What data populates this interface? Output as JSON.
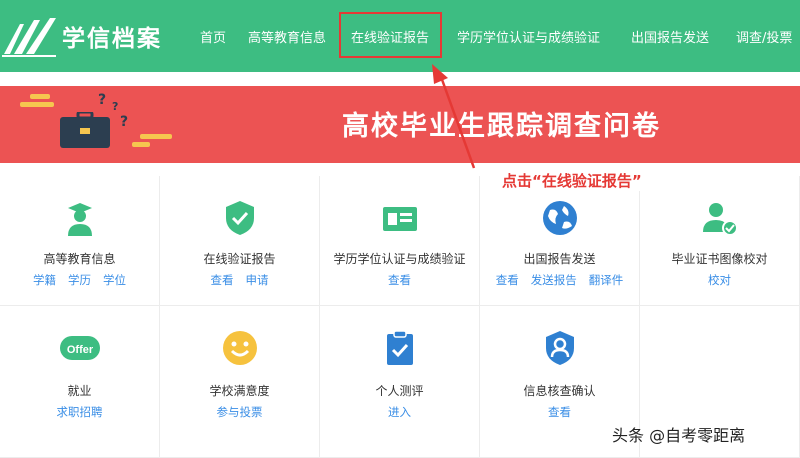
{
  "header": {
    "logo_text": "学信档案",
    "nav": [
      "首页",
      "高等教育信息",
      "在线验证报告",
      "学历学位认证与成绩验证",
      "出国报告发送",
      "调查/投票"
    ]
  },
  "banner": {
    "title": "高校毕业生跟踪调查问卷"
  },
  "annotation": "点击“在线验证报告”",
  "row1": [
    {
      "title": "高等教育信息",
      "links": [
        "学籍",
        "学历",
        "学位"
      ]
    },
    {
      "title": "在线验证报告",
      "links": [
        "查看",
        "申请"
      ]
    },
    {
      "title": "学历学位认证与成绩验证",
      "links": [
        "查看"
      ]
    },
    {
      "title": "出国报告发送",
      "links": [
        "查看",
        "发送报告",
        "翻译件"
      ]
    },
    {
      "title": "毕业证书图像校对",
      "links": [
        "校对"
      ]
    }
  ],
  "row2": [
    {
      "title": "就业",
      "links": [
        "求职招聘"
      ],
      "badge": "Offer"
    },
    {
      "title": "学校满意度",
      "links": [
        "参与投票"
      ]
    },
    {
      "title": "个人测评",
      "links": [
        "进入"
      ]
    },
    {
      "title": "信息核查确认",
      "links": [
        "查看"
      ]
    }
  ],
  "watermark": "头条 @自考零距离",
  "colors": {
    "brand_green": "#3dbd82",
    "banner_red": "#ec5353",
    "link_blue": "#3a8ee6",
    "annotation_red": "#e53935"
  }
}
